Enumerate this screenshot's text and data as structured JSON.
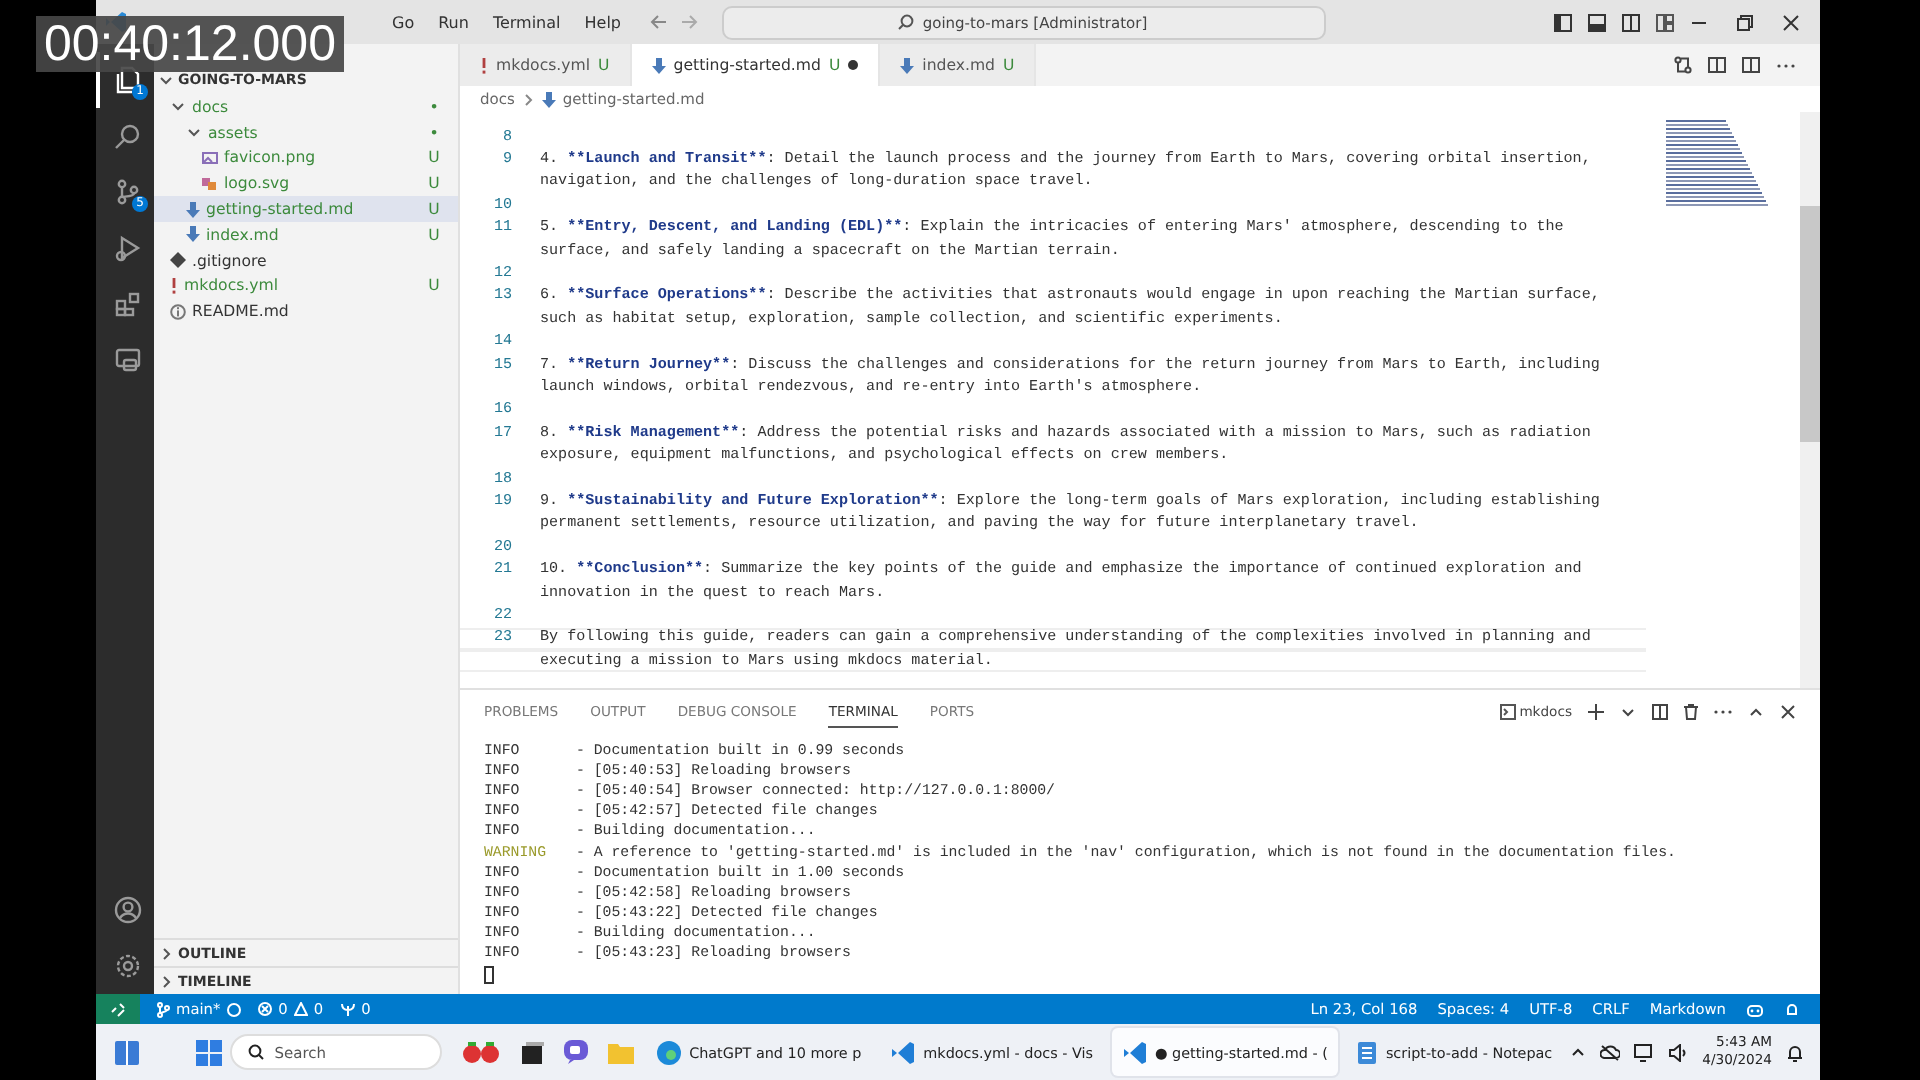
{
  "overlay": {
    "timestamp": "00:40:12.000"
  },
  "menu": [
    "Go",
    "Run",
    "Terminal",
    "Help"
  ],
  "title_search": "going-to-mars [Administrator]",
  "activity_bar": {
    "items": [
      {
        "kind": "files",
        "badge": "1",
        "selected": true
      },
      {
        "kind": "search",
        "selected": false
      },
      {
        "kind": "source-control",
        "badge": "5",
        "selected": false
      },
      {
        "kind": "run",
        "selected": false
      },
      {
        "kind": "extensions",
        "selected": false
      },
      {
        "kind": "remote",
        "selected": false
      }
    ],
    "bottom": [
      {
        "kind": "account"
      },
      {
        "kind": "settings"
      }
    ]
  },
  "sidebar": {
    "root": "GOING-TO-MARS",
    "tree": [
      {
        "label": "docs",
        "kind": "folder",
        "badge": "•",
        "untracked": true,
        "selected": false,
        "expanded": true,
        "children": [
          {
            "label": "assets",
            "kind": "folder",
            "badge": "•",
            "untracked": true,
            "selected": false,
            "expanded": true,
            "children": [
              {
                "label": "favicon.png",
                "kind": "image",
                "badge": "U",
                "untracked": true,
                "selected": false
              },
              {
                "label": "logo.svg",
                "kind": "svg",
                "badge": "U",
                "untracked": true,
                "selected": false
              }
            ]
          },
          {
            "label": "getting-started.md",
            "kind": "markdown",
            "badge": "U",
            "untracked": true,
            "selected": true
          },
          {
            "label": "index.md",
            "kind": "markdown",
            "badge": "U",
            "untracked": true,
            "selected": false
          }
        ]
      },
      {
        "label": ".gitignore",
        "kind": "git",
        "untracked": false,
        "selected": false
      },
      {
        "label": "mkdocs.yml",
        "kind": "yaml",
        "badge": "U",
        "untracked": true,
        "selected": false
      },
      {
        "label": "README.md",
        "kind": "info",
        "untracked": false,
        "selected": false
      }
    ],
    "sections": [
      {
        "label": "OUTLINE",
        "expanded": false
      },
      {
        "label": "TIMELINE",
        "expanded": false
      }
    ]
  },
  "editor": {
    "tabs": [
      {
        "label": "mkdocs.yml",
        "kind": "yaml",
        "badge": "U",
        "selected": false,
        "dirty": false
      },
      {
        "label": "getting-started.md",
        "kind": "markdown",
        "badge": "U",
        "selected": true,
        "dirty": true
      },
      {
        "label": "index.md",
        "kind": "markdown",
        "badge": "U",
        "selected": false,
        "dirty": false
      }
    ],
    "breadcrumbs": [
      "docs",
      "getting-started.md"
    ],
    "lines": [
      {
        "number": "8",
        "current": false
      },
      {
        "number": "9",
        "current": false,
        "segments": [
          {
            "kind": "plain",
            "text": "4. "
          },
          {
            "kind": "strong",
            "text": "**Launch and Transit**"
          },
          {
            "kind": "plain",
            "text": ": Detail the launch process and the journey from Earth to Mars, covering orbital insertion,"
          }
        ]
      },
      {
        "current": false,
        "segments": [
          {
            "kind": "plain",
            "text": "navigation, and the challenges of long-duration space travel."
          }
        ]
      },
      {
        "number": "10",
        "current": false
      },
      {
        "number": "11",
        "current": false,
        "segments": [
          {
            "kind": "plain",
            "text": "5. "
          },
          {
            "kind": "strong",
            "text": "**Entry, Descent, and Landing (EDL)**"
          },
          {
            "kind": "plain",
            "text": ": Explain the intricacies of entering Mars' atmosphere, descending to the"
          }
        ]
      },
      {
        "current": false,
        "segments": [
          {
            "kind": "plain",
            "text": "surface, and safely landing a spacecraft on the Martian terrain."
          }
        ]
      },
      {
        "number": "12",
        "current": false
      },
      {
        "number": "13",
        "current": false,
        "segments": [
          {
            "kind": "plain",
            "text": "6. "
          },
          {
            "kind": "strong",
            "text": "**Surface Operations**"
          },
          {
            "kind": "plain",
            "text": ": Describe the activities that astronauts would engage in upon reaching the Martian surface,"
          }
        ]
      },
      {
        "current": false,
        "segments": [
          {
            "kind": "plain",
            "text": "such as habitat setup, exploration, sample collection, and scientific experiments."
          }
        ]
      },
      {
        "number": "14",
        "current": false
      },
      {
        "number": "15",
        "current": false,
        "segments": [
          {
            "kind": "plain",
            "text": "7. "
          },
          {
            "kind": "strong",
            "text": "**Return Journey**"
          },
          {
            "kind": "plain",
            "text": ": Discuss the challenges and considerations for the return journey from Mars to Earth, including"
          }
        ]
      },
      {
        "current": false,
        "segments": [
          {
            "kind": "plain",
            "text": "launch windows, orbital rendezvous, and re-entry into Earth's atmosphere."
          }
        ]
      },
      {
        "number": "16",
        "current": false
      },
      {
        "number": "17",
        "current": false,
        "segments": [
          {
            "kind": "plain",
            "text": "8. "
          },
          {
            "kind": "strong",
            "text": "**Risk Management**"
          },
          {
            "kind": "plain",
            "text": ": Address the potential risks and hazards associated with a mission to Mars, such as radiation"
          }
        ]
      },
      {
        "current": false,
        "segments": [
          {
            "kind": "plain",
            "text": "exposure, equipment malfunctions, and psychological effects on crew members."
          }
        ]
      },
      {
        "number": "18",
        "current": false
      },
      {
        "number": "19",
        "current": false,
        "segments": [
          {
            "kind": "plain",
            "text": "9. "
          },
          {
            "kind": "strong",
            "text": "**Sustainability and Future Exploration**"
          },
          {
            "kind": "plain",
            "text": ": Explore the long-term goals of Mars exploration, including establishing"
          }
        ]
      },
      {
        "current": false,
        "segments": [
          {
            "kind": "plain",
            "text": "permanent settlements, resource utilization, and paving the way for future interplanetary travel."
          }
        ]
      },
      {
        "number": "20",
        "current": false
      },
      {
        "number": "21",
        "current": false,
        "segments": [
          {
            "kind": "plain",
            "text": "10. "
          },
          {
            "kind": "strong",
            "text": "**Conclusion**"
          },
          {
            "kind": "plain",
            "text": ": Summarize the key points of the guide and emphasize the importance of continued exploration and"
          }
        ]
      },
      {
        "current": false,
        "segments": [
          {
            "kind": "plain",
            "text": "innovation in the quest to reach Mars."
          }
        ]
      },
      {
        "number": "22",
        "current": false
      },
      {
        "number": "23",
        "current": true,
        "segments": [
          {
            "kind": "plain",
            "text": "By following this guide, readers can gain a comprehensive understanding of the complexities involved in planning and"
          }
        ]
      },
      {
        "current": true,
        "segments": [
          {
            "kind": "plain",
            "text": "executing a mission to Mars using mkdocs material."
          }
        ]
      }
    ]
  },
  "panel": {
    "tabs": [
      {
        "label": "PROBLEMS",
        "selected": false
      },
      {
        "label": "OUTPUT",
        "selected": false
      },
      {
        "label": "DEBUG CONSOLE",
        "selected": false
      },
      {
        "label": "TERMINAL",
        "selected": true
      },
      {
        "label": "PORTS",
        "selected": false
      }
    ],
    "terminal_name": "mkdocs",
    "lines": [
      {
        "level": "INFO",
        "kind": "info",
        "message": "- Documentation built in 0.99 seconds"
      },
      {
        "level": "INFO",
        "kind": "info",
        "message": "- [05:40:53] Reloading browsers"
      },
      {
        "level": "INFO",
        "kind": "info",
        "message": "- [05:40:54] Browser connected: http://127.0.0.1:8000/"
      },
      {
        "level": "INFO",
        "kind": "info",
        "message": "- [05:42:57] Detected file changes"
      },
      {
        "level": "INFO",
        "kind": "info",
        "message": "- Building documentation..."
      },
      {
        "level": "WARNING",
        "kind": "warning",
        "message": "- A reference to 'getting-started.md' is included in the 'nav' configuration, which is not found in the documentation files."
      },
      {
        "level": "INFO",
        "kind": "info",
        "message": "- Documentation built in 1.00 seconds"
      },
      {
        "level": "INFO",
        "kind": "info",
        "message": "- [05:42:58] Reloading browsers"
      },
      {
        "level": "INFO",
        "kind": "info",
        "message": "- [05:43:22] Detected file changes"
      },
      {
        "level": "INFO",
        "kind": "info",
        "message": "- Building documentation..."
      },
      {
        "level": "INFO",
        "kind": "info",
        "message": "- [05:43:23] Reloading browsers"
      }
    ]
  },
  "status_bar": {
    "branch": "main*",
    "errors": "0",
    "warnings": "0",
    "ports": "0",
    "right": [
      "Ln 23, Col 168",
      "Spaces: 4",
      "UTF-8",
      "CRLF",
      "Markdown"
    ]
  },
  "taskbar": {
    "search_placeholder": "Search",
    "apps": [
      {
        "kind": "edge",
        "label": "ChatGPT and 10 more p",
        "selected": false
      },
      {
        "kind": "vscode",
        "label": "mkdocs.yml - docs - Vis",
        "selected": false
      },
      {
        "kind": "vscode",
        "label": "● getting-started.md - (",
        "selected": true
      },
      {
        "kind": "notepad",
        "label": "script-to-add - Notepac",
        "selected": false
      }
    ],
    "time": "5:43 AM",
    "date": "4/30/2024"
  }
}
